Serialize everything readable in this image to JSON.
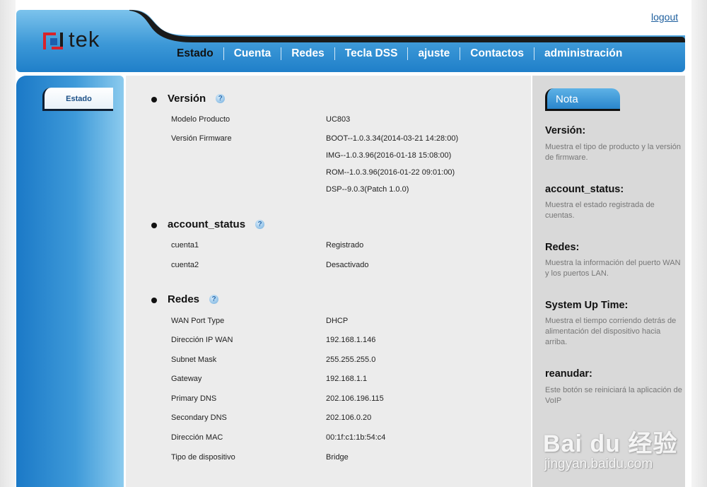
{
  "header": {
    "logo_text": "tek",
    "logout_label": "logout",
    "nav": [
      "Estado",
      "Cuenta",
      "Redes",
      "Tecla DSS",
      "ajuste",
      "Contactos",
      "administración"
    ]
  },
  "sidebar": {
    "items": [
      {
        "label": "Estado"
      }
    ]
  },
  "sections": {
    "version": {
      "title": "Versión",
      "rows": [
        {
          "label": "Modelo Producto",
          "value": "UC803"
        },
        {
          "label": "Versión Firmware",
          "value": "BOOT--1.0.3.34(2014-03-21 14:28:00)"
        },
        {
          "label": "",
          "value": "IMG--1.0.3.96(2016-01-18 15:08:00)"
        },
        {
          "label": "",
          "value": "ROM--1.0.3.96(2016-01-22 09:01:00)"
        },
        {
          "label": "",
          "value": "DSP--9.0.3(Patch 1.0.0)"
        }
      ]
    },
    "account_status": {
      "title": "account_status",
      "rows": [
        {
          "label": "cuenta1",
          "value": "Registrado"
        },
        {
          "label": "cuenta2",
          "value": "Desactivado"
        }
      ]
    },
    "redes": {
      "title": "Redes",
      "rows": [
        {
          "label": "WAN Port Type",
          "value": "DHCP"
        },
        {
          "label": "Dirección IP WAN",
          "value": "192.168.1.146"
        },
        {
          "label": "Subnet Mask",
          "value": "255.255.255.0"
        },
        {
          "label": "Gateway",
          "value": "192.168.1.1"
        },
        {
          "label": "Primary DNS",
          "value": "202.106.196.115"
        },
        {
          "label": "Secondary DNS",
          "value": "202.106.0.20"
        },
        {
          "label": "Dirección MAC",
          "value": "00:1f:c1:1b:54:c4"
        },
        {
          "label": "Tipo de dispositivo",
          "value": "Bridge"
        }
      ]
    }
  },
  "note": {
    "tab_label": "Nota",
    "items": [
      {
        "title": "Versión:",
        "desc": "Muestra el tipo de producto y la versión de firmware."
      },
      {
        "title": "account_status:",
        "desc": "Muestra el estado registrada de cuentas."
      },
      {
        "title": "Redes:",
        "desc": "Muestra la información del puerto WAN y los puertos LAN."
      },
      {
        "title": "System Up Time:",
        "desc": "Muestra el tiempo corriendo detrás de alimentación del dispositivo hacia arriba."
      },
      {
        "title": "reanudar:",
        "desc": "Este botón se reiniciará la aplicación de VoIP"
      }
    ]
  },
  "watermark": {
    "main": "Bai du 经验",
    "sub": "jingyan.baidu.com"
  },
  "colors": {
    "header_blue": "#3c98d7",
    "link": "#1e5f9e",
    "note_text": "#777777"
  }
}
